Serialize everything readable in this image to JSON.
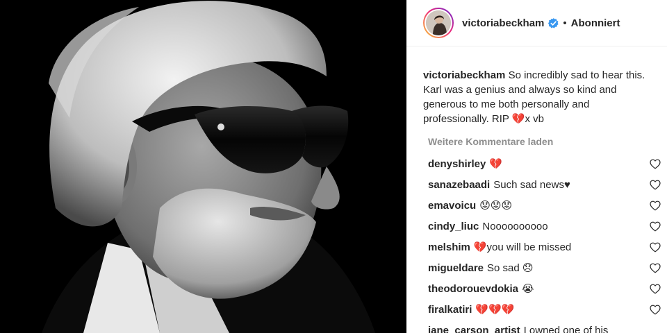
{
  "post": {
    "image_alt": "Black and white portrait of a man with white hair, dark sunglasses and a white beard",
    "header": {
      "username": "victoriabeckham",
      "separator": "•",
      "follow_status": "Abonniert"
    },
    "caption": {
      "username": "victoriabeckham",
      "text": "So incredibly sad to hear this. Karl was a genius and always so kind and generous to me both personally and professionally. RIP 💔x vb"
    },
    "load_more_label": "Weitere Kommentare laden",
    "comments": [
      {
        "username": "denyshirley",
        "text": "💔"
      },
      {
        "username": "sanazebaadi",
        "text": "Such sad news♥"
      },
      {
        "username": "emavoicu",
        "text": "😟😟😟"
      },
      {
        "username": "cindy_liuc",
        "text": "Noooooooooo"
      },
      {
        "username": "melshim",
        "text": "💔you will be missed"
      },
      {
        "username": "migueldare",
        "text": "So sad 😞"
      },
      {
        "username": "theodorouevdokia",
        "text": "😭"
      },
      {
        "username": "firalkatiri",
        "text": "💔💔💔"
      },
      {
        "username": "jane_carson_artist",
        "text": "I owned one of his"
      }
    ]
  },
  "colors": {
    "text": "#262626",
    "muted": "#8e8e8e",
    "verified": "#3897f0",
    "photo_bg": "#000000"
  },
  "icons": {
    "verified": "verified-badge-icon",
    "like": "heart-outline-icon"
  }
}
